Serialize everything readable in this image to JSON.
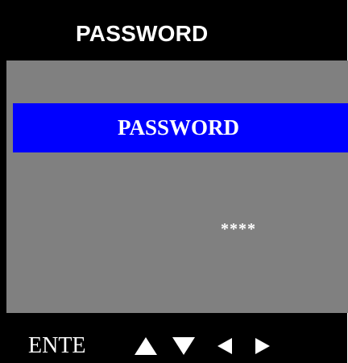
{
  "header": {
    "title": "PASSWORD"
  },
  "menu": {
    "selected_item": "PASSWORD"
  },
  "password_field": {
    "masked_value": "****"
  },
  "footer": {
    "enter_label": "ENTE",
    "keys": [
      "up-arrow-icon",
      "down-arrow-icon",
      "left-arrow-icon",
      "right-arrow-icon"
    ]
  },
  "colors": {
    "background": "#000000",
    "panel": "#808080",
    "highlight": "#0000ff",
    "text": "#ffffff"
  }
}
